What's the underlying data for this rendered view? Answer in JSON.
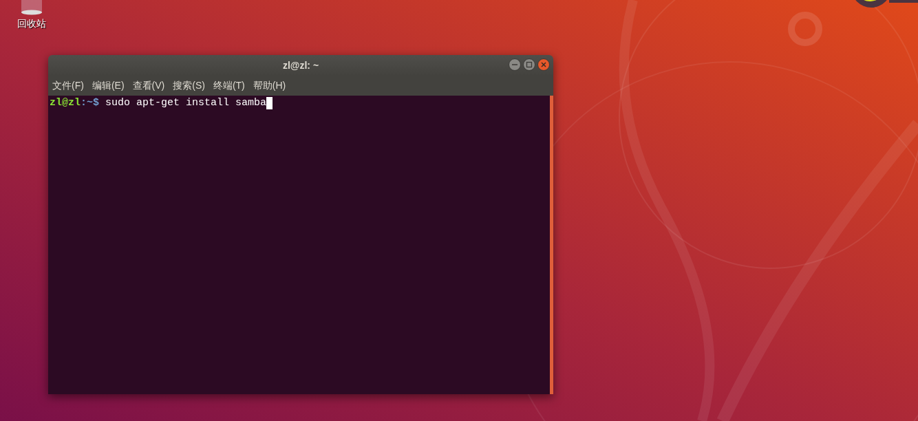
{
  "desktop": {
    "icons": [
      {
        "label": "回收站"
      }
    ]
  },
  "terminal": {
    "title": "zl@zl: ~",
    "menu": [
      "文件(F)",
      "编辑(E)",
      "查看(V)",
      "搜索(S)",
      "终端(T)",
      "帮助(H)"
    ],
    "prompt": {
      "user": "zl@zl",
      "path": ":~$"
    },
    "command": "sudo apt-get install samba",
    "cursor_visible": true
  }
}
